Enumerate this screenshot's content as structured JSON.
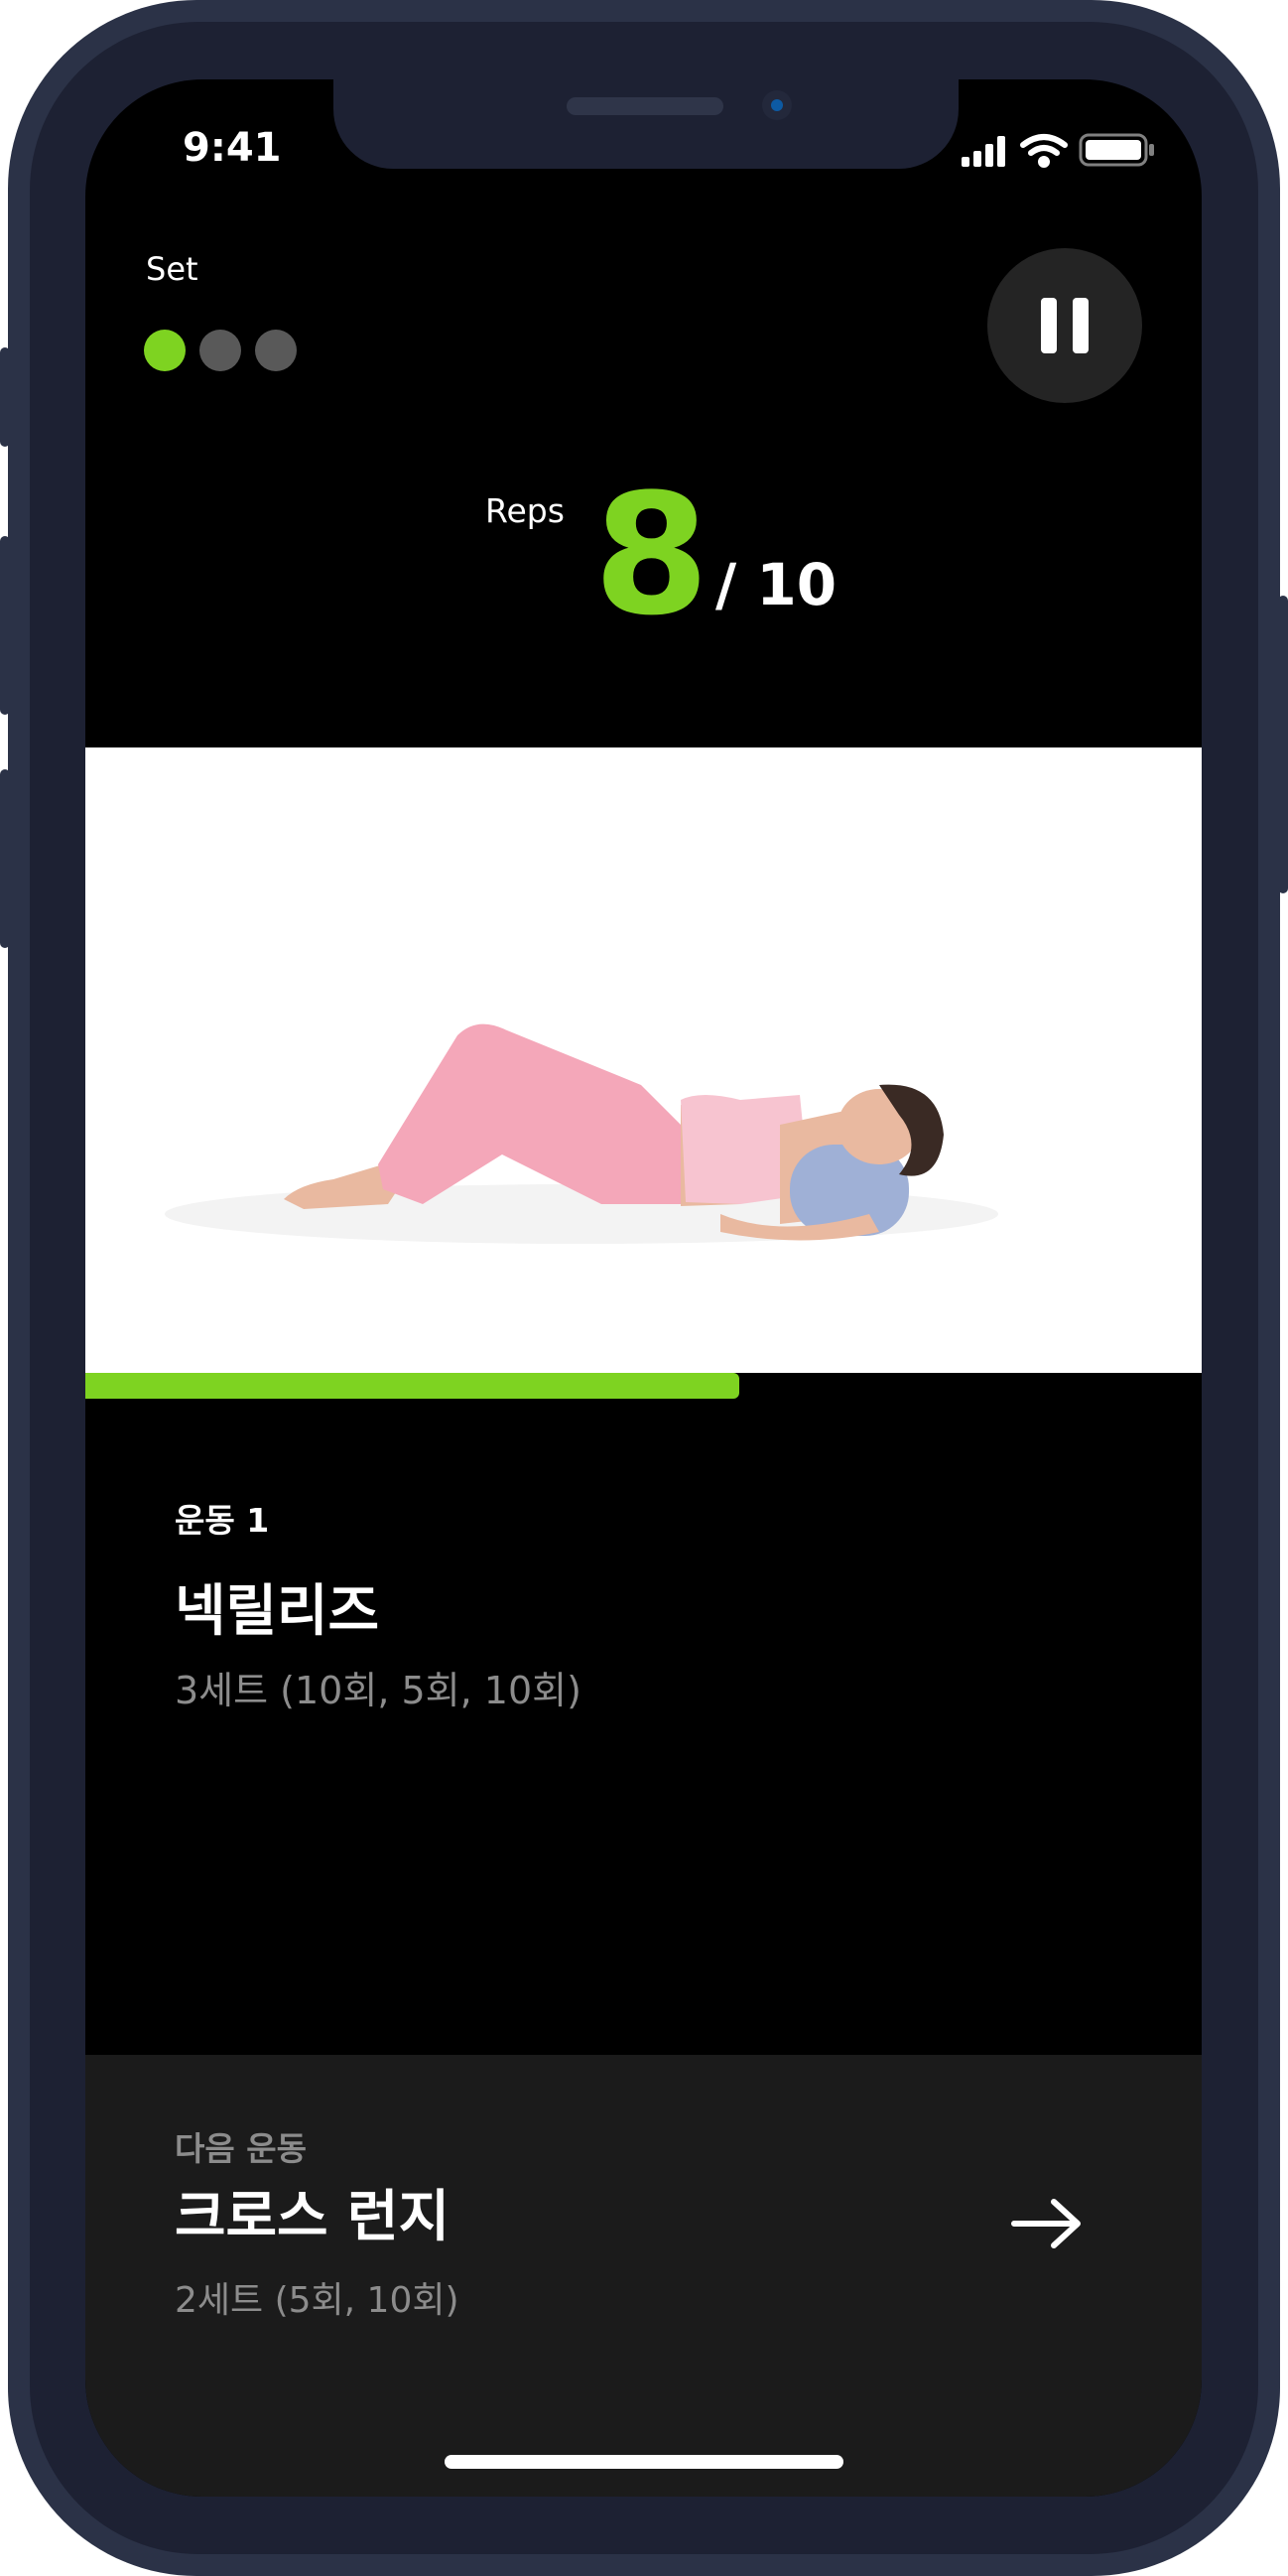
{
  "status_bar": {
    "time": "9:41"
  },
  "workout": {
    "set_label": "Set",
    "sets": [
      {
        "state": "active",
        "color": "#7ed321"
      },
      {
        "state": "pending",
        "color": "#595959"
      },
      {
        "state": "pending",
        "color": "#595959"
      }
    ],
    "reps_label": "Reps",
    "reps_current": "8",
    "reps_total": "/ 10",
    "progress_fraction": 0.586
  },
  "current_exercise": {
    "index_label": "운동 1",
    "name": "넥릴리즈",
    "sets_detail": "3세트 (10회, 5회, 10회)"
  },
  "next_exercise": {
    "label": "다음 운동",
    "name": "크로스 런지",
    "sets_detail": "2세트 (5회, 10회)"
  },
  "colors": {
    "accent": "#7ed321",
    "background": "#000000",
    "panel": "#1b1b1b",
    "muted_text": "#8c8c8c"
  },
  "icons": {
    "pause": "pause-icon",
    "next": "arrow-right-icon"
  }
}
